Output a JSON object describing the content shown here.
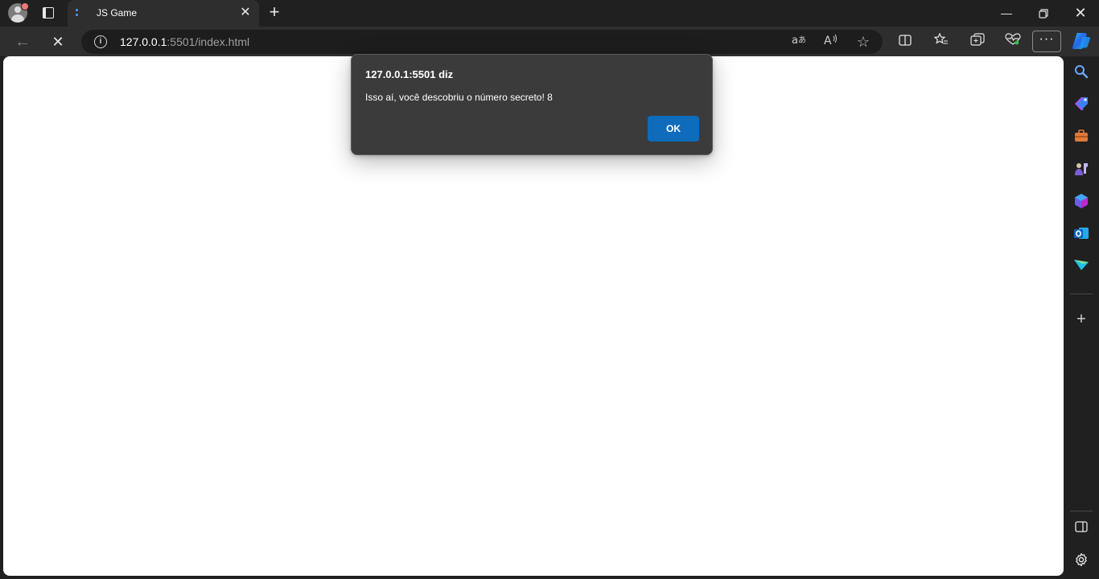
{
  "tab": {
    "title": "JS Game"
  },
  "address": {
    "host": "127.0.0.1",
    "rest": ":5501/index.html"
  },
  "dialog": {
    "origin": "127.0.0.1:5501 diz",
    "message": "Isso aí, você descobriu o número secreto! 8",
    "ok_label": "OK"
  },
  "toolbar": {
    "icons": [
      "back-icon",
      "stop-loading-icon",
      "site-info-icon",
      "translate-icon",
      "read-aloud-icon",
      "favorite-star-icon",
      "split-screen-icon",
      "favorites-icon",
      "collections-icon",
      "browser-essentials-icon",
      "more-options-icon",
      "copilot-icon"
    ]
  },
  "sidebar": {
    "icons": [
      "search-icon",
      "shopping-icon",
      "tools-icon",
      "games-icon",
      "microsoft-365-icon",
      "outlook-icon",
      "drop-icon",
      "add-icon",
      "hide-sidebar-icon",
      "settings-icon"
    ]
  },
  "colors": {
    "accent": "#0f6cbd",
    "dialog_bg": "#3b3b3b",
    "chrome_bg": "#202020"
  }
}
